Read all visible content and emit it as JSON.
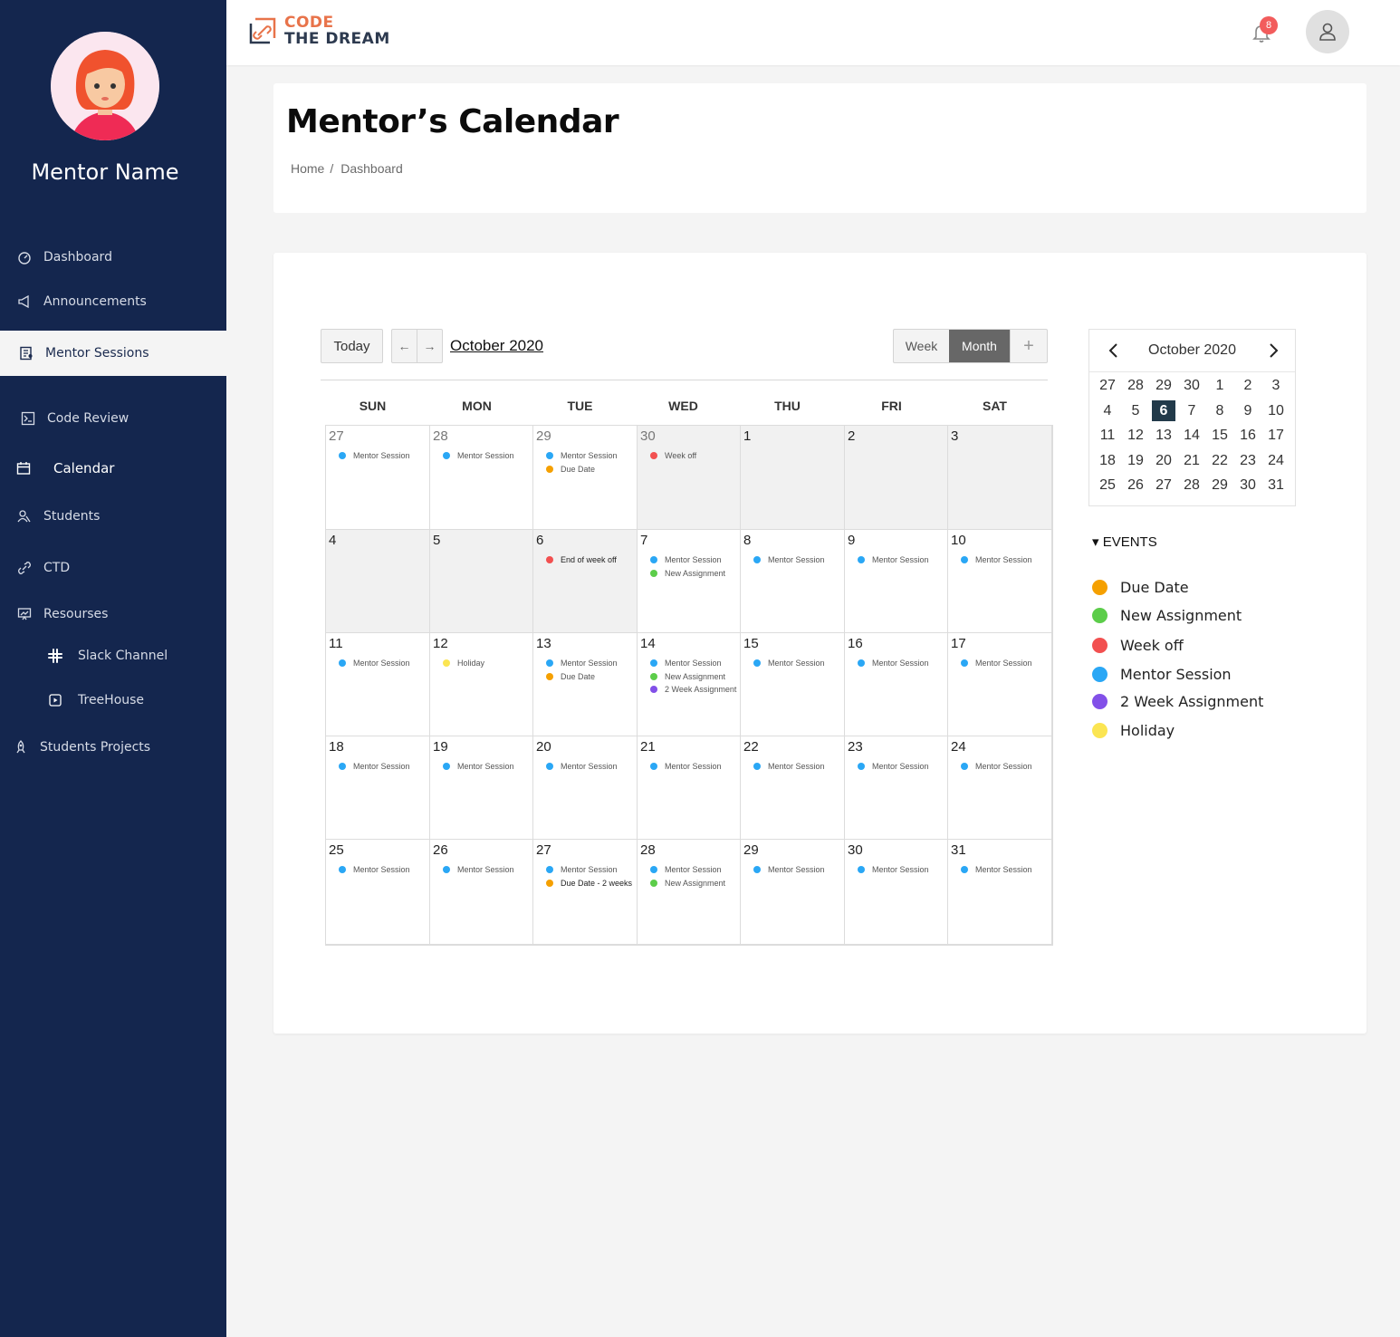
{
  "user": {
    "name": "Mentor Name"
  },
  "sidebar": {
    "items": [
      {
        "label": "Dashboard",
        "icon": "dashboard-icon"
      },
      {
        "label": "Announcements",
        "icon": "megaphone-icon"
      },
      {
        "label": "Mentor Sessions",
        "icon": "clipboard-user-icon",
        "active": true
      },
      {
        "label": "Code Review",
        "icon": "terminal-icon"
      },
      {
        "label": "Calendar",
        "icon": "calendar-icon"
      },
      {
        "label": "Students",
        "icon": "students-icon"
      },
      {
        "label": "CTD",
        "icon": "link-icon"
      },
      {
        "label": "Resourses",
        "icon": "presentation-icon"
      },
      {
        "label": "Slack Channel",
        "icon": "slack-icon"
      },
      {
        "label": "TreeHouse",
        "icon": "play-square-icon"
      },
      {
        "label": "Students Projects",
        "icon": "rocket-icon"
      }
    ]
  },
  "topbar": {
    "logo_line1": "CODE",
    "logo_line2": "THE DREAM",
    "notification_count": "8"
  },
  "header": {
    "title": "Mentor’s Calendar",
    "breadcrumb": [
      "Home",
      "/",
      "Dashboard"
    ]
  },
  "calendar": {
    "today_label": "Today",
    "prev": "←",
    "next": "→",
    "month_title": "October 2020",
    "views": {
      "week": "Week",
      "month": "Month",
      "add": "+"
    },
    "weekdays": [
      "SUN",
      "MON",
      "TUE",
      "WED",
      "THU",
      "FRI",
      "SAT"
    ],
    "colors": {
      "due": "#f5a000",
      "new": "#5ccd4a",
      "off": "#f25050",
      "mentor": "#2aa7f5",
      "two": "#8250e8",
      "holiday": "#fbe552"
    },
    "weeks": [
      [
        {
          "day": "27",
          "other": true,
          "events": [
            {
              "t": "Mentor Session",
              "c": "mentor"
            }
          ]
        },
        {
          "day": "28",
          "other": true,
          "events": [
            {
              "t": "Mentor Session",
              "c": "mentor"
            }
          ]
        },
        {
          "day": "29",
          "other": true,
          "events": [
            {
              "t": "Mentor Session",
              "c": "mentor"
            },
            {
              "t": "Due Date",
              "c": "due"
            }
          ]
        },
        {
          "day": "30",
          "other": true,
          "grey": true,
          "events": [
            {
              "t": "Week off",
              "c": "off"
            }
          ]
        },
        {
          "day": "1",
          "grey": true,
          "events": []
        },
        {
          "day": "2",
          "grey": true,
          "events": []
        },
        {
          "day": "3",
          "grey": true,
          "events": []
        }
      ],
      [
        {
          "day": "4",
          "grey": true,
          "events": []
        },
        {
          "day": "5",
          "grey": true,
          "events": []
        },
        {
          "day": "6",
          "grey": true,
          "events": [
            {
              "t": "End of week off",
              "c": "off",
              "strong": true
            }
          ]
        },
        {
          "day": "7",
          "events": [
            {
              "t": "Mentor Session",
              "c": "mentor"
            },
            {
              "t": "New Assignment",
              "c": "new"
            }
          ]
        },
        {
          "day": "8",
          "events": [
            {
              "t": "Mentor Session",
              "c": "mentor"
            }
          ]
        },
        {
          "day": "9",
          "events": [
            {
              "t": "Mentor Session",
              "c": "mentor"
            }
          ]
        },
        {
          "day": "10",
          "events": [
            {
              "t": "Mentor Session",
              "c": "mentor"
            }
          ]
        }
      ],
      [
        {
          "day": "11",
          "events": [
            {
              "t": "Mentor Session",
              "c": "mentor"
            }
          ]
        },
        {
          "day": "12",
          "events": [
            {
              "t": "Holiday",
              "c": "holiday"
            }
          ]
        },
        {
          "day": "13",
          "events": [
            {
              "t": "Mentor Session",
              "c": "mentor"
            },
            {
              "t": "Due Date",
              "c": "due"
            }
          ]
        },
        {
          "day": "14",
          "events": [
            {
              "t": "Mentor Session",
              "c": "mentor"
            },
            {
              "t": "New Assignment",
              "c": "new"
            },
            {
              "t": "2 Week Assignment",
              "c": "two"
            }
          ]
        },
        {
          "day": "15",
          "events": [
            {
              "t": "Mentor Session",
              "c": "mentor"
            }
          ]
        },
        {
          "day": "16",
          "events": [
            {
              "t": "Mentor Session",
              "c": "mentor"
            }
          ]
        },
        {
          "day": "17",
          "events": [
            {
              "t": "Mentor Session",
              "c": "mentor"
            }
          ]
        }
      ],
      [
        {
          "day": "18",
          "events": [
            {
              "t": "Mentor Session",
              "c": "mentor"
            }
          ]
        },
        {
          "day": "19",
          "events": [
            {
              "t": "Mentor Session",
              "c": "mentor"
            }
          ]
        },
        {
          "day": "20",
          "events": [
            {
              "t": "Mentor Session",
              "c": "mentor"
            }
          ]
        },
        {
          "day": "21",
          "events": [
            {
              "t": "Mentor Session",
              "c": "mentor"
            }
          ]
        },
        {
          "day": "22",
          "events": [
            {
              "t": "Mentor Session",
              "c": "mentor"
            }
          ]
        },
        {
          "day": "23",
          "events": [
            {
              "t": "Mentor Session",
              "c": "mentor"
            }
          ]
        },
        {
          "day": "24",
          "events": [
            {
              "t": "Mentor Session",
              "c": "mentor"
            }
          ]
        }
      ],
      [
        {
          "day": "25",
          "events": [
            {
              "t": "Mentor Session",
              "c": "mentor"
            }
          ]
        },
        {
          "day": "26",
          "events": [
            {
              "t": "Mentor Session",
              "c": "mentor"
            }
          ]
        },
        {
          "day": "27",
          "events": [
            {
              "t": "Mentor Session",
              "c": "mentor"
            },
            {
              "t": "Due Date - 2 weeks",
              "c": "due",
              "strong": true
            }
          ]
        },
        {
          "day": "28",
          "events": [
            {
              "t": "Mentor Session",
              "c": "mentor"
            },
            {
              "t": "New Assignment",
              "c": "new"
            }
          ]
        },
        {
          "day": "29",
          "events": [
            {
              "t": "Mentor Session",
              "c": "mentor"
            }
          ]
        },
        {
          "day": "30",
          "events": [
            {
              "t": "Mentor Session",
              "c": "mentor"
            }
          ]
        },
        {
          "day": "31",
          "events": [
            {
              "t": "Mentor Session",
              "c": "mentor"
            }
          ]
        }
      ]
    ]
  },
  "mini_calendar": {
    "title": "October 2020",
    "prev": "‹",
    "next": "›",
    "selected": "6",
    "rows": [
      [
        "27",
        "28",
        "29",
        "30",
        "1",
        "2",
        "3"
      ],
      [
        "4",
        "5",
        "6",
        "7",
        "8",
        "9",
        "10"
      ],
      [
        "11",
        "12",
        "13",
        "14",
        "15",
        "16",
        "17"
      ],
      [
        "18",
        "19",
        "20",
        "21",
        "22",
        "23",
        "24"
      ],
      [
        "25",
        "26",
        "27",
        "28",
        "29",
        "30",
        "31"
      ]
    ]
  },
  "events_legend": {
    "title": "▾ EVENTS",
    "items": [
      {
        "label": "Due Date",
        "color": "#f5a000"
      },
      {
        "label": "New Assignment",
        "color": "#5ccd4a"
      },
      {
        "label": "Week off",
        "color": "#f25050"
      },
      {
        "label": "Mentor Session",
        "color": "#2aa7f5"
      },
      {
        "label": "2 Week Assignment",
        "color": "#8250e8"
      },
      {
        "label": "Holiday",
        "color": "#fbe552"
      }
    ]
  }
}
